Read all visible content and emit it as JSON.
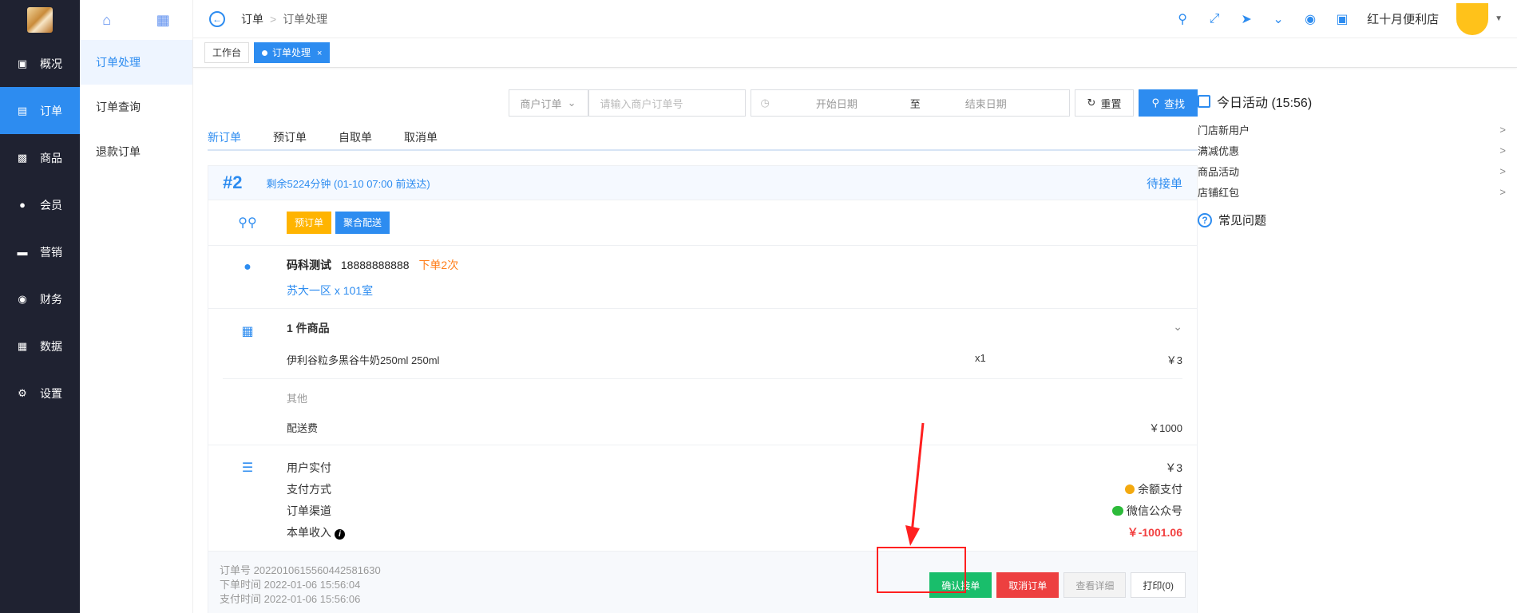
{
  "nav": {
    "items": [
      {
        "label": "概况"
      },
      {
        "label": "订单"
      },
      {
        "label": "商品"
      },
      {
        "label": "会员"
      },
      {
        "label": "营销"
      },
      {
        "label": "财务"
      },
      {
        "label": "数据"
      },
      {
        "label": "设置"
      }
    ]
  },
  "subnav": {
    "items": [
      {
        "label": "订单处理"
      },
      {
        "label": "订单查询"
      },
      {
        "label": "退款订单"
      }
    ]
  },
  "header": {
    "breadcrumb": [
      "订单",
      "订单处理"
    ],
    "store_name": "红十月便利店"
  },
  "tabs": {
    "workbench": "工作台",
    "active": "订单处理",
    "close": "×"
  },
  "filter": {
    "type_select": "商户订单",
    "order_placeholder": "请输入商户订单号",
    "start_placeholder": "开始日期",
    "to": "至",
    "end_placeholder": "结束日期",
    "reset_label": "重置",
    "search_label": "查找"
  },
  "order_tabs": [
    "新订单",
    "预订单",
    "自取单",
    "取消单"
  ],
  "order": {
    "number": "#2",
    "remaining": "剩余5224分钟 (01-10 07:00 前送达)",
    "status": "待接单",
    "badges": [
      "预订单",
      "聚合配送"
    ],
    "customer_name": "码科测试",
    "customer_phone": "18888888888",
    "order_count": "下单2次",
    "address": "苏大一区 x 101室",
    "goods_title": "1 件商品",
    "goods": [
      {
        "name": "伊利谷粒多黑谷牛奶250ml 250ml",
        "qty": "x1",
        "price": "￥3"
      }
    ],
    "other_label": "其他",
    "delivery_label": "配送费",
    "delivery_fee": "￥1000",
    "paid_label": "用户实付",
    "paid_value": "￥3",
    "pay_method_label": "支付方式",
    "pay_method_value": "余额支付",
    "channel_label": "订单渠道",
    "channel_value": "微信公众号",
    "income_label": "本单收入",
    "income_value": "￥-1001.06",
    "order_no": "订单号 2022010615560442581630",
    "order_time": "下单时间 2022-01-06 15:56:04",
    "pay_time": "支付时间 2022-01-06 15:56:06",
    "actions": {
      "confirm": "确认接单",
      "cancel": "取消订单",
      "detail": "查看详细",
      "print": "打印(0)"
    }
  },
  "right_panel": {
    "title": "今日活动 (15:56)",
    "items": [
      "门店新用户",
      "满减优惠",
      "商品活动",
      "店铺红包"
    ],
    "faq": "常见问题"
  },
  "colors": {
    "primary": "#2d8cf0",
    "nav_bg": "#1f2231",
    "confirm": "#19be6b",
    "cancel": "#ed4040",
    "highlight": "#ff2020"
  }
}
